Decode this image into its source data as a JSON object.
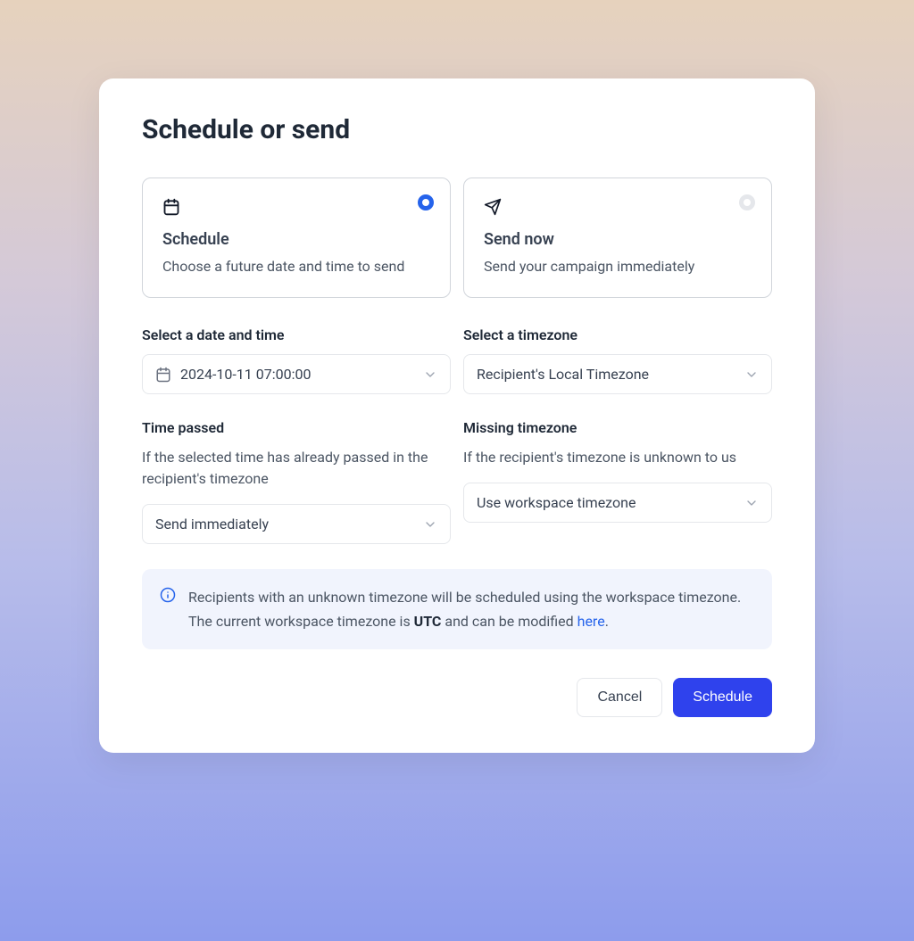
{
  "dialog": {
    "title": "Schedule or send"
  },
  "options": {
    "schedule": {
      "title": "Schedule",
      "description": "Choose a future date and time to send",
      "selected": true
    },
    "send_now": {
      "title": "Send now",
      "description": "Send your campaign immediately",
      "selected": false
    }
  },
  "fields": {
    "datetime": {
      "label": "Select a date and time",
      "value": "2024-10-11 07:00:00"
    },
    "timezone": {
      "label": "Select a timezone",
      "value": "Recipient's Local Timezone"
    },
    "time_passed": {
      "label": "Time passed",
      "help": "If the selected time has already passed in the recipient's timezone",
      "value": "Send immediately"
    },
    "missing_timezone": {
      "label": "Missing timezone",
      "help": "If the recipient's timezone is unknown to us",
      "value": "Use workspace timezone"
    }
  },
  "alert": {
    "text_prefix": "Recipients with an unknown timezone will be scheduled using the workspace timezone. The current workspace timezone is ",
    "strong": "UTC",
    "text_middle": " and can be modified ",
    "link_text": "here",
    "text_suffix": "."
  },
  "actions": {
    "cancel": "Cancel",
    "submit": "Schedule"
  }
}
